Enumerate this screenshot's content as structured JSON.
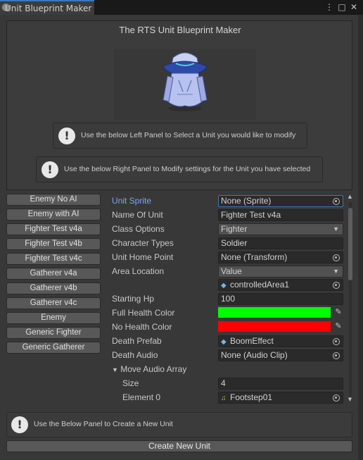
{
  "tab": {
    "title": "Unit Blueprint Maker"
  },
  "window_controls": {
    "menu": "⋮",
    "maximize": "□",
    "close": "✕"
  },
  "header": {
    "title": "The RTS Unit Blueprint Maker",
    "help_left": "Use the below Left Panel to Select a Unit you would like to modify",
    "help_right": "Use the below Right Panel to Modify settings for the Unit you have selected"
  },
  "unit_list": [
    "Enemy No AI",
    "Enemy with AI",
    "Fighter Test v4a",
    "Fighter Test v4b",
    "Fighter Test v4c",
    "Gatherer v4a",
    "Gatherer v4b",
    "Gatherer v4c",
    "Enemy",
    "Generic Fighter",
    "Generic Gatherer"
  ],
  "inspector": {
    "unit_sprite": {
      "label": "Unit Sprite",
      "value": "None (Sprite)"
    },
    "name_of_unit": {
      "label": "Name Of Unit",
      "value": "Fighter Test v4a"
    },
    "class_options": {
      "label": "Class Options",
      "value": "Fighter"
    },
    "character_types": {
      "label": "Character Types",
      "value": "Soldier"
    },
    "unit_home_point": {
      "label": "Unit Home Point",
      "value": "None (Transform)"
    },
    "area_location": {
      "label": "Area Location",
      "value": "Value",
      "sub_value": "controlledArea1"
    },
    "starting_hp": {
      "label": "Starting Hp",
      "value": "100"
    },
    "full_health_color": {
      "label": "Full Health Color",
      "color": "#00ff00"
    },
    "no_health_color": {
      "label": "No Health Color",
      "color": "#ff0000"
    },
    "death_prefab": {
      "label": "Death Prefab",
      "value": "BoomEffect"
    },
    "death_audio": {
      "label": "Death Audio",
      "value": "None (Audio Clip)"
    },
    "move_audio_array": {
      "label": "Move Audio Array",
      "size_label": "Size",
      "size": "4",
      "element0_label": "Element 0",
      "element0": "Footstep01"
    }
  },
  "footer": {
    "help": "Use the Below Panel to Create a New Unit",
    "create_button": "Create New Unit"
  },
  "icons": {
    "help": "!",
    "dropdown_caret": "▼",
    "eyedropper": "✎",
    "prefab": "◆",
    "audio": "♫",
    "foldout": "▼"
  },
  "colors": {
    "accent": "#3a79bb",
    "active_label": "#7ba7ea"
  }
}
